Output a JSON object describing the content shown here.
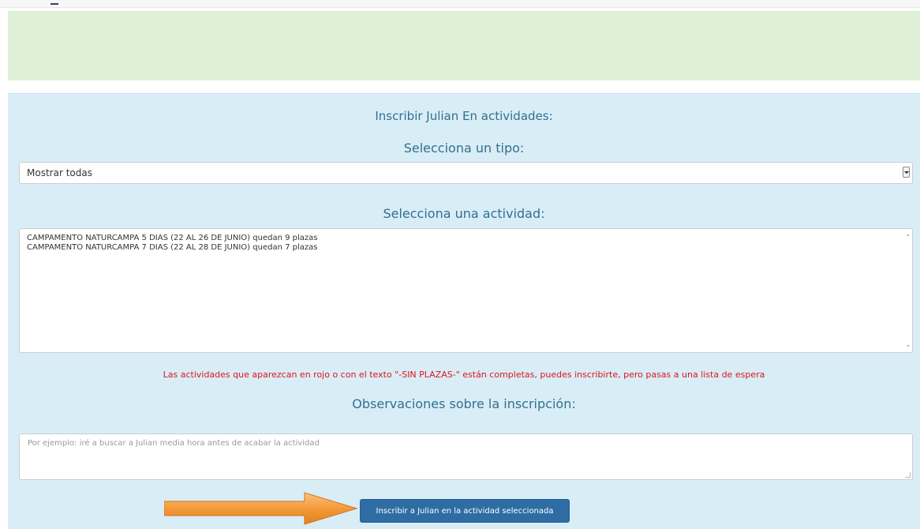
{
  "enrollment": {
    "title": "Inscribir Julian En actividades:",
    "type_heading": "Selecciona un tipo:",
    "type_select_value": "Mostrar todas",
    "activity_heading": "Selecciona una actividad:",
    "activities": [
      "CAMPAMENTO NATURCAMPA 5 DIAS (22 AL 26 DE JUNIO) quedan 9 plazas",
      "CAMPAMENTO NATURCAMPA 7 DIAS (22 AL 28 DE JUNIO) quedan 7 plazas"
    ],
    "warning": "Las actividades que aparezcan en rojo o con el texto \"-SIN PLAZAS-\" están completas, puedes inscribirte, pero pasas a una lista de espera",
    "notes_heading": "Observaciones sobre la inscripción:",
    "notes_placeholder": "Por ejemplo: iré a buscar a Julian media hora antes de acabar la actividad",
    "submit_label": "Inscribir a Julian en la actividad seleccionada"
  },
  "colors": {
    "success_panel_bg": "#dff0d8",
    "info_panel_bg": "#d9edf7",
    "heading_text": "#31708f",
    "warning_text": "#e0141c",
    "primary_button": "#2e6da4",
    "annotation_arrow": "#f39a3a"
  },
  "icons": {
    "select_arrow": "chevron-down-icon",
    "annotation": "arrow-right-icon"
  }
}
